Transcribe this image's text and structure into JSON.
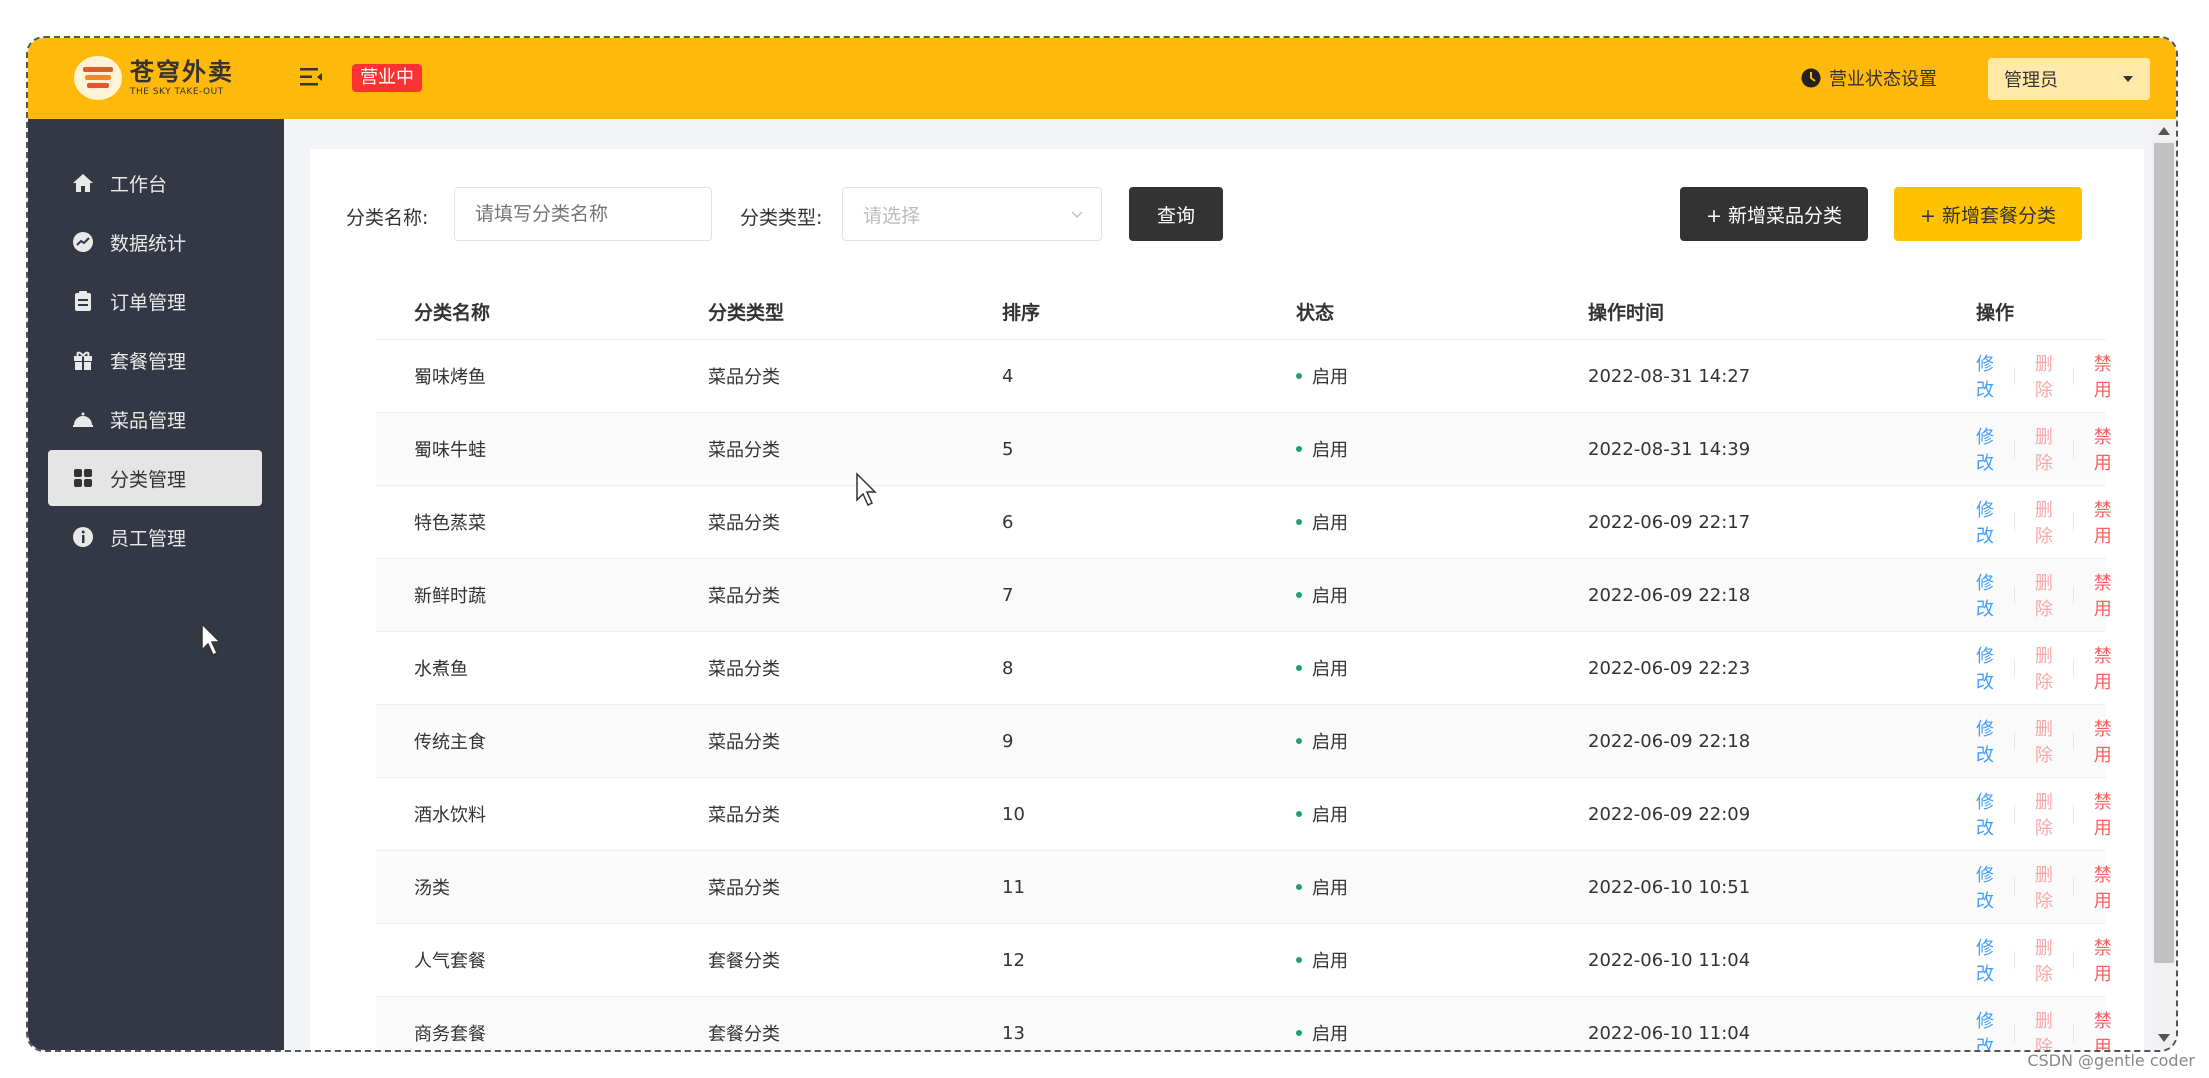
{
  "header": {
    "logo_cn": "苍穹外卖",
    "logo_en": "THE SKY TAKE-OUT",
    "status_badge": "营业中",
    "status_setting": "营业状态设置",
    "user": "管理员"
  },
  "sidebar": {
    "items": [
      {
        "label": "工作台",
        "icon": "home-icon"
      },
      {
        "label": "数据统计",
        "icon": "chart-icon"
      },
      {
        "label": "订单管理",
        "icon": "clipboard-icon"
      },
      {
        "label": "套餐管理",
        "icon": "gift-icon"
      },
      {
        "label": "菜品管理",
        "icon": "cloche-icon"
      },
      {
        "label": "分类管理",
        "icon": "grid-icon",
        "active": true
      },
      {
        "label": "员工管理",
        "icon": "info-icon"
      }
    ]
  },
  "filters": {
    "name_label": "分类名称:",
    "name_placeholder": "请填写分类名称",
    "type_label": "分类类型:",
    "type_placeholder": "请选择",
    "query_button": "查询",
    "add_dish_category": "+ 新增菜品分类",
    "add_setmeal_category": "+ 新增套餐分类"
  },
  "table": {
    "headers": [
      "分类名称",
      "分类类型",
      "排序",
      "状态",
      "操作时间",
      "操作"
    ],
    "actions": {
      "edit": "修改",
      "delete": "删除",
      "disable": "禁用"
    },
    "rows": [
      {
        "name": "蜀味烤鱼",
        "type": "菜品分类",
        "sort": "4",
        "status": "启用",
        "time": "2022-08-31 14:27"
      },
      {
        "name": "蜀味牛蛙",
        "type": "菜品分类",
        "sort": "5",
        "status": "启用",
        "time": "2022-08-31 14:39"
      },
      {
        "name": "特色蒸菜",
        "type": "菜品分类",
        "sort": "6",
        "status": "启用",
        "time": "2022-06-09 22:17"
      },
      {
        "name": "新鲜时蔬",
        "type": "菜品分类",
        "sort": "7",
        "status": "启用",
        "time": "2022-06-09 22:18"
      },
      {
        "name": "水煮鱼",
        "type": "菜品分类",
        "sort": "8",
        "status": "启用",
        "time": "2022-06-09 22:23"
      },
      {
        "name": "传统主食",
        "type": "菜品分类",
        "sort": "9",
        "status": "启用",
        "time": "2022-06-09 22:18"
      },
      {
        "name": "酒水饮料",
        "type": "菜品分类",
        "sort": "10",
        "status": "启用",
        "time": "2022-06-09 22:09"
      },
      {
        "name": "汤类",
        "type": "菜品分类",
        "sort": "11",
        "status": "启用",
        "time": "2022-06-10 10:51"
      },
      {
        "name": "人气套餐",
        "type": "套餐分类",
        "sort": "12",
        "status": "启用",
        "time": "2022-06-10 11:04"
      },
      {
        "name": "商务套餐",
        "type": "套餐分类",
        "sort": "13",
        "status": "启用",
        "time": "2022-06-10 11:04"
      }
    ]
  },
  "watermark": "CSDN @gentle coder",
  "colors": {
    "header_bg": "#ffb90a",
    "sidebar_bg": "#343744",
    "badge_red": "#fd3333",
    "edit_blue": "#419efe",
    "status_green": "#22a06b"
  }
}
